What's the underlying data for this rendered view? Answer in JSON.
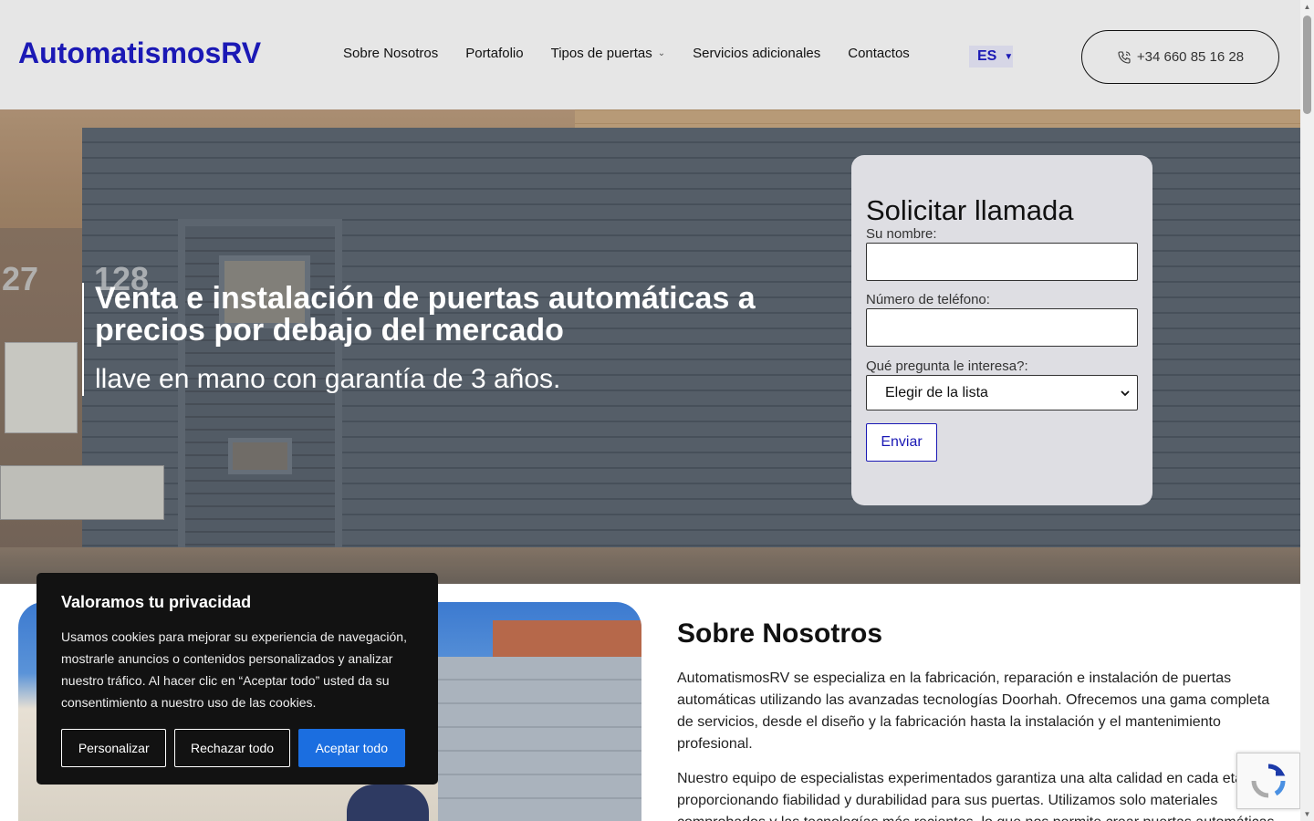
{
  "header": {
    "logo": "AutomatismosRV",
    "nav": [
      {
        "label": "Sobre Nosotros"
      },
      {
        "label": "Portafolio"
      },
      {
        "label": "Tipos de puertas",
        "has_dropdown": true
      },
      {
        "label": "Servicios adicionales"
      },
      {
        "label": "Contactos"
      }
    ],
    "language": "ES",
    "phone": "+34 660 85 16 28"
  },
  "hero": {
    "title": "Venta e instalación de puertas automáticas a precios por debajo del mercado",
    "subtitle": "llave en mano con garantía de 3 años.",
    "house_numbers": [
      "27",
      "128"
    ]
  },
  "form": {
    "title": "Solicitar llamada",
    "name_label": "Su nombre:",
    "name_value": "",
    "phone_label": "Número de teléfono:",
    "phone_value": "",
    "question_label": "Qué pregunta le interesa?:",
    "question_selected": "Elegir de la lista",
    "submit": "Enviar"
  },
  "about": {
    "title": "Sobre Nosotros",
    "paragraph1": "AutomatismosRV se especializa en la fabricación, reparación e instalación de puertas automáticas utilizando las avanzadas tecnologías Doorhah. Ofrecemos una gama completa de servicios, desde el diseño y la fabricación hasta la instalación y el mantenimiento profesional.",
    "paragraph2": "Nuestro equipo de especialistas experimentados garantiza una alta calidad en cada etapa, proporcionando fiabilidad y durabilidad para sus puertas. Utilizamos solo materiales comprobados y las tecnologías más recientes, lo que nos permite crear puertas automáticas"
  },
  "cookie": {
    "title": "Valoramos tu privacidad",
    "text": "Usamos cookies para mejorar su experiencia de navegación, mostrarle anuncios o contenidos personalizados y analizar nuestro tráfico. Al hacer clic en “Aceptar todo” usted da su consentimiento a nuestro uso de las cookies.",
    "customize": "Personalizar",
    "reject": "Rechazar todo",
    "accept": "Aceptar todo"
  },
  "colors": {
    "brand": "#1b19b5",
    "accept": "#1b6ee0",
    "header_bg": "#e6e6e6",
    "cookie_bg": "#121212"
  }
}
